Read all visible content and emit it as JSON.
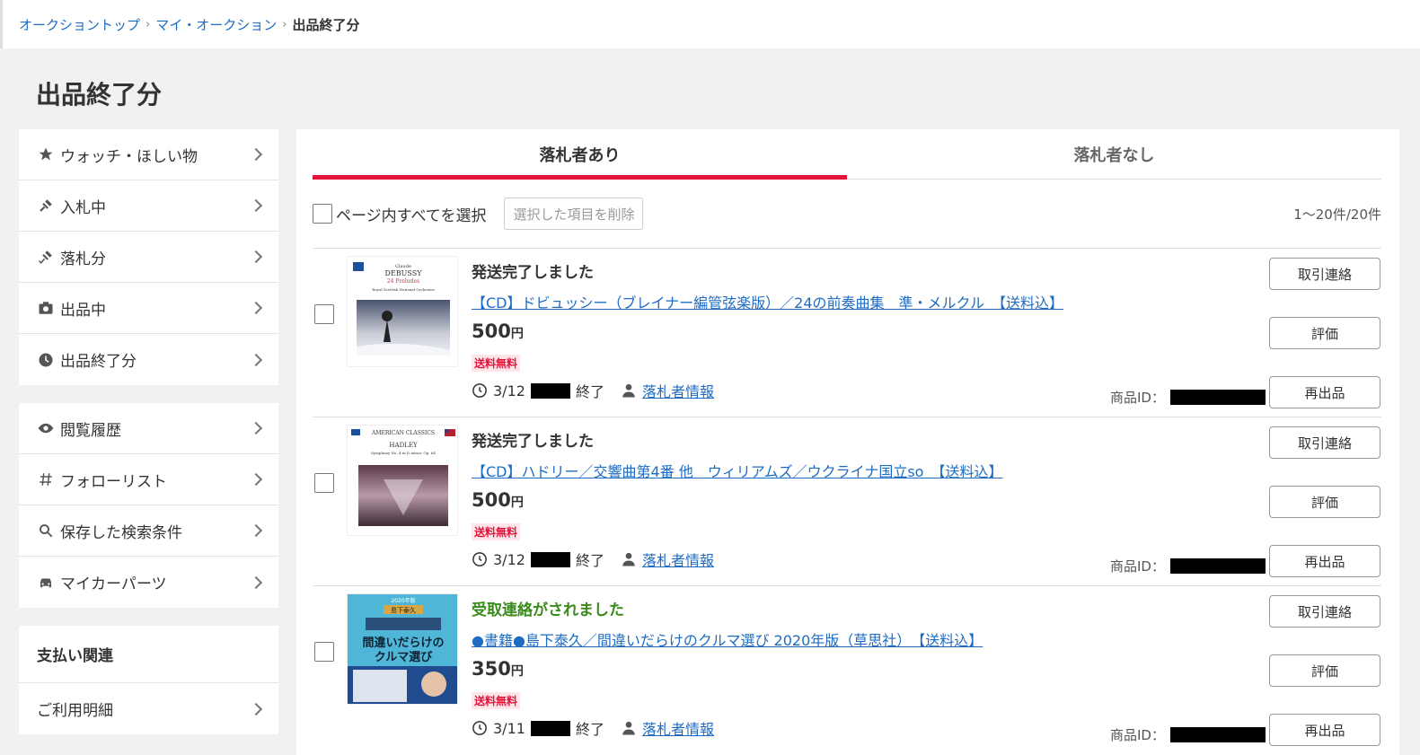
{
  "breadcrumb": {
    "items": [
      "オークショントップ",
      "マイ・オークション"
    ],
    "current": "出品終了分",
    "separator": "›"
  },
  "page_title": "出品終了分",
  "sidebar": {
    "group1": [
      {
        "label": "ウォッチ・ほしい物",
        "icon": "star-icon"
      },
      {
        "label": "入札中",
        "icon": "gavel-icon"
      },
      {
        "label": "落札分",
        "icon": "gavel-won-icon"
      },
      {
        "label": "出品中",
        "icon": "camera-icon"
      },
      {
        "label": "出品終了分",
        "icon": "clock-icon"
      }
    ],
    "group2": [
      {
        "label": "閲覧履歴",
        "icon": "eye-icon"
      },
      {
        "label": "フォローリスト",
        "icon": "hash-icon"
      },
      {
        "label": "保存した検索条件",
        "icon": "search-icon"
      },
      {
        "label": "マイカーパーツ",
        "icon": "car-icon"
      }
    ],
    "payment_heading": "支払い関連",
    "payment_items": [
      {
        "label": "ご利用明細"
      }
    ]
  },
  "tabs": {
    "active": "落札者あり",
    "inactive": "落札者なし"
  },
  "toolbar": {
    "select_all": "ページ内すべてを選択",
    "delete_selected": "選択した項目を削除",
    "count": "1〜20件/20件"
  },
  "items": [
    {
      "status": "発送完了しました",
      "status_color": "#333333",
      "title": "【CD】ドビュッシー（ブレイナー編管弦楽版）／24の前奏曲集　準・メルクル　【送料込】",
      "price": "500",
      "yen": "円",
      "free_shipping": "送料無料",
      "end_date": "3/12",
      "end_label": "終了",
      "winner_info": "落札者情報",
      "product_id_label": "商品ID：",
      "thumb_text": {
        "line1": "Claude",
        "line2": "DEBUSSY",
        "line3": "24 Preludes",
        "line4": "Royal Scottish National Orchestra"
      }
    },
    {
      "status": "発送完了しました",
      "status_color": "#333333",
      "title": "【CD】ハドリー／交響曲第4番 他　ウィリアムズ／ウクライナ国立so　【送料込】",
      "price": "500",
      "yen": "円",
      "free_shipping": "送料無料",
      "end_date": "3/12",
      "end_label": "終了",
      "winner_info": "落札者情報",
      "product_id_label": "商品ID：",
      "thumb_text": {
        "line1": "AMERICAN CLASSICS",
        "line2": "HADLEY",
        "line3": "Symphony No. 4 in D minor, Op. 64",
        "line4": ""
      }
    },
    {
      "status": "受取連絡がされました",
      "status_color": "#3a8a1c",
      "title": "●書籍●島下泰久／間違いだらけのクルマ選び 2020年版（草思社）　【送料込】",
      "price": "350",
      "yen": "円",
      "free_shipping": "送料無料",
      "end_date": "3/11",
      "end_label": "終了",
      "winner_info": "落札者情報",
      "product_id_label": "商品ID：",
      "thumb_text": {
        "line1": "2020年版",
        "line2": "島下泰久",
        "line3": "間違いだらけの",
        "line4": "クルマ選び"
      }
    }
  ],
  "action_buttons": {
    "contact": "取引連絡",
    "rate": "評価",
    "relist": "再出品"
  }
}
